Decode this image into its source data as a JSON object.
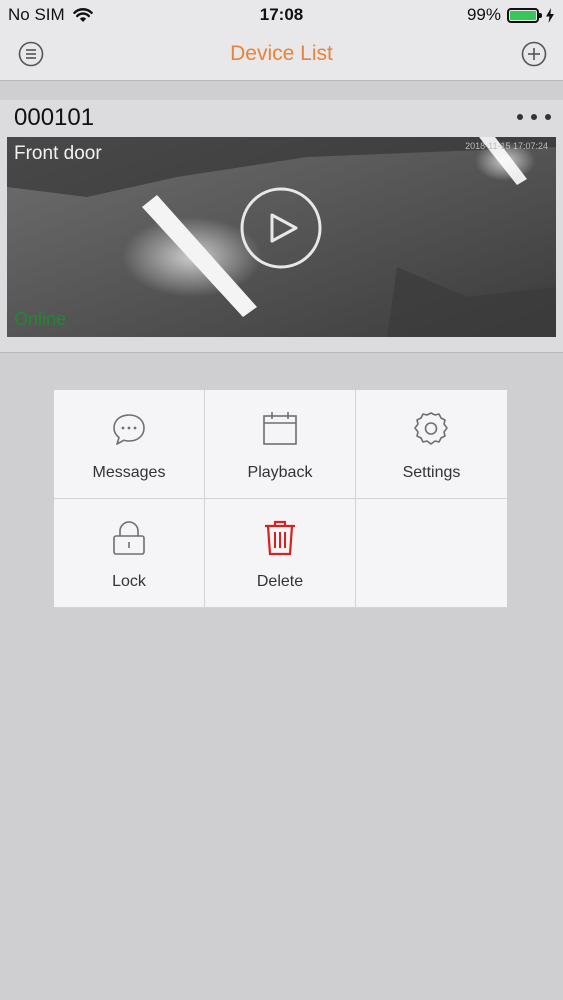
{
  "status_bar": {
    "carrier": "No SIM",
    "time": "17:08",
    "battery_percent": "99%",
    "battery_level": 0.99,
    "wifi_icon": "wifi-icon",
    "charging_icon": "charging-bolt-icon"
  },
  "nav": {
    "title": "Device List",
    "menu_icon": "menu-list-icon",
    "add_icon": "add-plus-icon"
  },
  "device": {
    "id": "000101",
    "camera_name": "Front door",
    "status": "Online",
    "timestamp": "2018-11-15 17:07:24",
    "more_icon": "more-dots-icon",
    "play_icon": "play-icon"
  },
  "actions": [
    {
      "label": "Messages",
      "icon": "chat-bubble-icon"
    },
    {
      "label": "Playback",
      "icon": "calendar-icon"
    },
    {
      "label": "Settings",
      "icon": "gear-icon"
    },
    {
      "label": "Lock",
      "icon": "lock-icon"
    },
    {
      "label": "Delete",
      "icon": "trash-icon"
    }
  ],
  "colors": {
    "accent": "#e9833a",
    "online": "#1e8a2e",
    "delete": "#d92020",
    "icon": "#6e6e73",
    "background": "#cfcfd2"
  }
}
